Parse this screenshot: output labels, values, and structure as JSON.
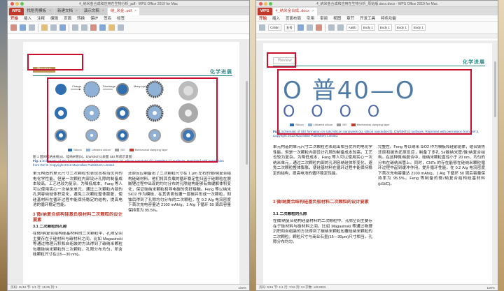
{
  "left_window": {
    "title": "4_纳米金合成和应用在生物分析_pdf - WPS Office 2019 for Mac",
    "tabs": [
      {
        "label": "WPS"
      },
      {
        "label": "找稻壳模板"
      },
      {
        "label": "新建文档"
      },
      {
        "label": "演示文稿"
      },
      {
        "label": "纳_米金..pdf"
      }
    ],
    "ribbon_tabs": [
      "开始",
      "插入",
      "注释",
      "编辑",
      "页面",
      "转换",
      "保护",
      "签名",
      "标签"
    ],
    "review_tag": "Review",
    "header_right": "化学进展",
    "caption_fig": "Fig. 1",
    "caption_text": "Schematic of SEI formation on solid silicon nanowires (a), silicon nanotube (b), DWSiNT (c) surfaces. Reprinted with permission from Ref 3. Copyright 2012 Macmillan Publishers Limited.",
    "caption_cn": "图 1 固体硅纳米线(a)、硅纳米管(b)、DWSiNT(c)表面 SEI 形成示意图",
    "legend": [
      "Silicon",
      "Lithiated silicon",
      "SEI",
      "Mechanical clamping layer"
    ],
    "col1": "单元构造的单元尺寸二次颗粒也表现出相当优异的电化学性能。但是一次颗粒内部设计孔隙的制备成本较高，工艺也较为复杂。为降低成本，Fang 等人可以使用实心一次纳米单元，通过二次颗粒内部的孔洞容纳硅体积变化，避免二次颗粒整体膨胀，使硅基材料在循环过程中能保持稳定的结构，提高电池的循环稳定性能。",
    "section3": "3 微/纳复合结构硅基负极材料二次颗粒的设计要素",
    "section31": "3.1 二次颗粒的孔隙",
    "col1b": "在微/纳复合结构硅基材料的二次颗粒中，孔隙空间主要存在于硅材料与碳材料之间。比如 Magasinski 等通过物理沉积和自组装的方法得到了碳纳米颗粒包覆硅纳米颗粒的二次颗粒。孔隙分布均匀，所含硅颗粒尺寸在(15—30 nm)。",
    "col2": "还原反应制备出了二次颗粒尺寸在 1 μm 左右的微/纳复合结构硅碳材料。他们将其负载的循环稳定性归因于硅颗粒在脱嵌锂过程中出现的均匀分布的孔隙结构能够有效缓解体积变化，保证硅纳米颗粒和导电碳的良好接触。Feng 等以纳米 SiO2 作为模板，在其表面包覆一层碳并形成一次颗粒，刻蚀后得到了孔隙均匀分布的二次颗粒，在 0.2 A/g 电流密度下首次充电容量达 2100 mAh/g，1 A/g 下循环 50 周后容量保持率为 95.5%。",
    "status": "页码: 11/16   节: 1/1   行: 11/25   列: 1",
    "zoom": "100%"
  },
  "right_window": {
    "title": "4_纳米金合成和应用在生物分析_原始版.docx.docx - WPS Office 2019 for Mac",
    "tabs": [
      {
        "label": "WPS"
      },
      {
        "label": "4_纳米金合成..docx"
      }
    ],
    "ribbon_tabs": [
      "开始",
      "插入",
      "页面布局",
      "引用",
      "审阅",
      "视图",
      "章节",
      "开发工具",
      "特色功能"
    ],
    "font_box": "Calibri",
    "size_box": "五号",
    "style_boxes": [
      "AaBb",
      "Body 1",
      "Body 1",
      "Body 1",
      "Body 1"
    ],
    "review_tag": "Review",
    "header_right": "化学进展",
    "ocr_big_text": "O 普40—O",
    "ocr_small_text": "O O O O",
    "legend": [
      "Silicon",
      "Lithiated silicon",
      "SEI",
      "Mechanical clamping layer"
    ],
    "caption_fig": "Fig.1",
    "caption_text": "Schematic of SEI formation on solid silicon nanowires (a), silicon nanotube (b), DWSiNT(c) surfaces. Reprinted with permission from Ref 3. Copyright 2012 Macmillan Publishers Limited.",
    "col1": "单元构造的单元尺寸二次颗粒也表现出相当优异的电化学性能。但是一次颗粒内部设计孔隙的制备成本较高，工艺也较为复杂。为降低成本，Fang 等人可以使用实心一次纳米单元，通过二次颗粒内部的孔洞容纳硅体积变化，避免二次颗粒整体膨胀，使硅基材料在循环过程中能保持稳定的结构，提高电池的循环稳定性能。",
    "section3": "3 微/纳复合结构硅基负极材料二次颗粒的设计要素",
    "section31": "3.1 二次颗粒的孔隙",
    "col1b": "在微/纳复合结构硅基材料的二次颗粒中，孔隙空间主要存在于硅材料与碳材料之间。比如 Magasinski 等通过物理沉积和自组装的方法得到了碳纳米颗粒包覆硅纳米颗粒的二次颗粒。颗粒尺寸与商业石墨(15—30μm)尺寸相当。孔隙分布均匀。",
    "col2": "完整性。Feng 等以纳米 SiO2 作为模板和硅前驱体，结合镁热还原和碳热还原反应，制备了多孔 Si/碳纳米管/微/纳复合结构。在这种微/纳复合中，硅纳米颗粒直径小于 20 nm，均匀的分布在碳纳米管上。同时，CNTs 的存在能够在硅纳米颗粒循环过程中起到缓冲作用，提升循环性能。在 0.2 A/g 电流密度下首次充电容量达 2100 mAh/g，1 A/g 下循环 50 周后容量保持率为 95.5%。Feng 等制备的微/纳复合结构硅基材料(pSi/C)。",
    "status": "页码: 6/16   节: 1/1   行: 7/16   列: 24   字数: 1/8,5003",
    "zoom": "100%"
  },
  "colors": {
    "highlight_red": "#c8102e",
    "wps_red": "#c0392b",
    "teal": "#2f8a8a",
    "ocr_blue": "#4e7aa6"
  }
}
